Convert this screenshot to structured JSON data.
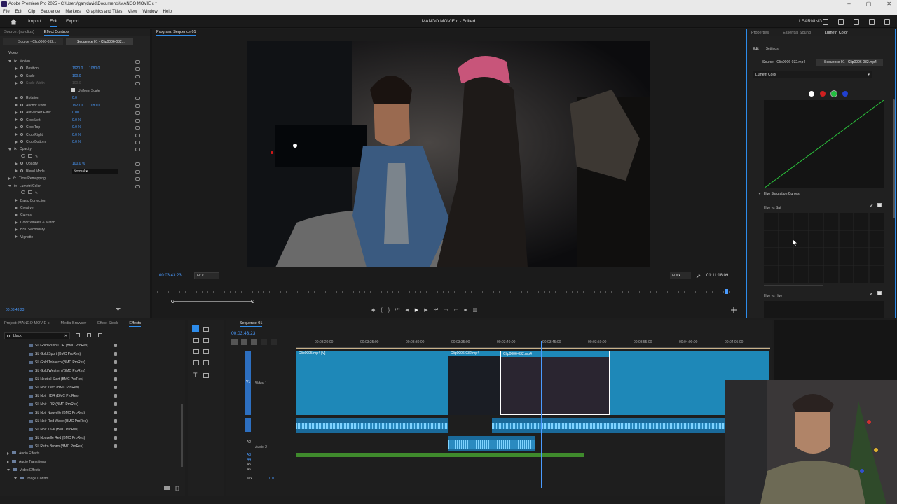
{
  "titlebar": {
    "text": "Adobe Premiere Pro 2025 - C:\\Users\\garydavid\\Documents\\MANGO MOVIE c *"
  },
  "menu": [
    "File",
    "Edit",
    "Clip",
    "Sequence",
    "Markers",
    "Graphics and Titles",
    "View",
    "Window",
    "Help"
  ],
  "header": {
    "nav": [
      "Import",
      "Edit",
      "Export"
    ],
    "project_title": "MANGO MOVIE c - Edited",
    "learning": "LEARNING"
  },
  "effect_controls": {
    "tabs": [
      "Source: (no clips)",
      "Effect Controls"
    ],
    "source_clip": "Source - Clip0006-032...",
    "seq_clip": "Sequence 01 - Clip0006-032...",
    "video_label": "Video",
    "rows": [
      {
        "label": "Motion",
        "indent": 0,
        "fx": true,
        "open": true
      },
      {
        "label": "Position",
        "indent": 1,
        "v1": "1920.0",
        "v2": "1080.0"
      },
      {
        "label": "Scale",
        "indent": 1,
        "v1": "100.0"
      },
      {
        "label": "Scale Width",
        "indent": 1,
        "v1": "100.0",
        "dim": true
      },
      {
        "label": "Uniform Scale",
        "indent": 2,
        "check": true
      },
      {
        "label": "Rotation",
        "indent": 1,
        "v1": "0.0"
      },
      {
        "label": "Anchor Point",
        "indent": 1,
        "v1": "1920.0",
        "v2": "1080.0"
      },
      {
        "label": "Anti-flicker Filter",
        "indent": 1,
        "v1": "0.00"
      },
      {
        "label": "Crop Left",
        "indent": 1,
        "v1": "0.0 %"
      },
      {
        "label": "Crop Top",
        "indent": 1,
        "v1": "0.0 %"
      },
      {
        "label": "Crop Right",
        "indent": 1,
        "v1": "0.0 %"
      },
      {
        "label": "Crop Bottom",
        "indent": 1,
        "v1": "0.0 %"
      },
      {
        "label": "Opacity",
        "indent": 0,
        "fx": true,
        "open": true
      },
      {
        "label": "",
        "indent": 1,
        "shapes": true
      },
      {
        "label": "Opacity",
        "indent": 1,
        "v1": "100.0 %"
      },
      {
        "label": "Blend Mode",
        "indent": 1,
        "select": "Normal"
      },
      {
        "label": "Time Remapping",
        "indent": 0,
        "fx": true
      },
      {
        "label": "Lumetri Color",
        "indent": 0,
        "fx": true,
        "open": true
      },
      {
        "label": "",
        "indent": 1,
        "shapes": true
      },
      {
        "label": "Basic Correction",
        "indent": 1
      },
      {
        "label": "Creative",
        "indent": 1
      },
      {
        "label": "Curves",
        "indent": 1
      },
      {
        "label": "Color Wheels & Match",
        "indent": 1
      },
      {
        "label": "HSL Secondary",
        "indent": 1
      },
      {
        "label": "Vignette",
        "indent": 1
      }
    ],
    "timecode": "00:03:43:23"
  },
  "program": {
    "title": "Program: Sequence 01",
    "timecode": "00:03:43:23",
    "fit": "Fit",
    "quality": "Full",
    "duration": "01:11:18:09"
  },
  "lumetri": {
    "tabs": [
      "Properties",
      "Essential Sound",
      "Lumetri Color"
    ],
    "subtabs": [
      "Edit",
      "Settings"
    ],
    "source_clip": "Source - Clip0006-032.mp4",
    "seq_clip": "Sequence 01 - Clip0006-032.mp4",
    "effect_select": "Lumetri Color",
    "hue_sat_title": "Hue Saturation Curves",
    "hue_vs_sat": "Hue vs Sat",
    "hue_vs_hue": "Hue vs Hue",
    "channel_colors": [
      "#ffffff",
      "#d02020",
      "#22c040",
      "#2040d0"
    ]
  },
  "project_panel": {
    "tabs": [
      "Project: MANGO MOVIE c",
      "Media Browser",
      "Effect Stock",
      "Effects"
    ],
    "search": "black",
    "items": [
      "SL Gold Rush LDR (BMC ProRes)",
      "SL Gold Sport (BMC ProRes)",
      "SL Gold Tobacco (BMC ProRes)",
      "SL Gold Western (BMC ProRes)",
      "SL Neutral Start (BMC ProRes)",
      "SL Noir 1965 (BMC ProRes)",
      "SL Noir HDR (BMC ProRes)",
      "SL Noir LDR (BMC ProRes)",
      "SL Noir Nouvelle (BMC ProRes)",
      "SL Noir Red Wave (BMC ProRes)",
      "SL Noir Tri-X (BMC ProRes)",
      "SL Nouvelle Red (BMC ProRes)",
      "SL Retro Brown (BMC ProRes)"
    ],
    "folders": [
      "Audio Effects",
      "Audio Transitions",
      "Video Effects",
      "Image Control"
    ]
  },
  "timeline": {
    "tab": "Sequence 01",
    "timecode": "00:03:43:23",
    "ruler": [
      "00:03:20:00",
      "00:03:25:00",
      "00:03:30:00",
      "00:03:35:00",
      "00:03:40:00",
      "00:03:45:00",
      "00:03:50:00",
      "00:03:55:00",
      "00:04:00:00",
      "00:04:05:00"
    ],
    "clips": [
      "Clip0005.mp4 [V]",
      "Clip0006-032.mp4",
      "Clip0006-032.mp4"
    ],
    "tracks": {
      "v1": "V1",
      "video1": "Video 1",
      "a2": "A2",
      "audio2": "Audio 2",
      "a3": "A3",
      "a4": "A4",
      "a5": "A5",
      "a6": "A6",
      "mix": "Mix",
      "mix_val": "0.0"
    }
  }
}
